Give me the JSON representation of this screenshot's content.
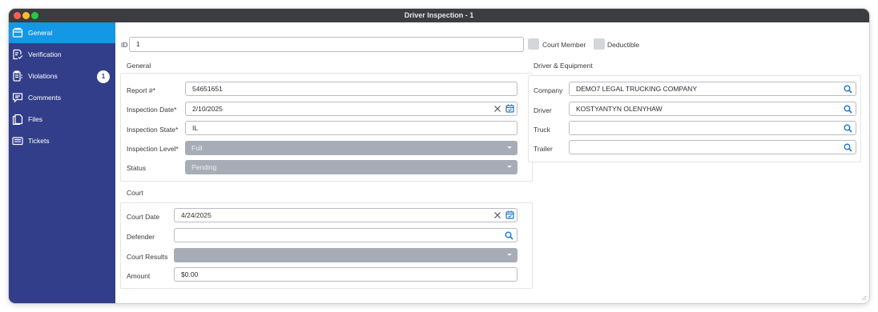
{
  "window": {
    "title": "Driver Inspection - 1"
  },
  "sidebar": {
    "items": [
      {
        "label": "General",
        "icon": "drawer-icon",
        "active": true
      },
      {
        "label": "Verification",
        "icon": "document-check-icon"
      },
      {
        "label": "Violations",
        "icon": "clipboard-list-icon",
        "badge": "1"
      },
      {
        "label": "Comments",
        "icon": "comment-icon"
      },
      {
        "label": "Files",
        "icon": "files-icon"
      },
      {
        "label": "Tickets",
        "icon": "ticket-icon"
      }
    ]
  },
  "top": {
    "id_label": "ID",
    "id_value": "1",
    "court_member_label": "Court Member",
    "deductible_label": "Deductible"
  },
  "general": {
    "title": "General",
    "report_label": "Report #*",
    "report_value": "54651651",
    "inspection_date_label": "Inspection Date*",
    "inspection_date_value": "2/10/2025",
    "inspection_state_label": "Inspection State*",
    "inspection_state_value": "IL",
    "inspection_level_label": "Inspection Level*",
    "inspection_level_value": "Full",
    "status_label": "Status",
    "status_value": "Pending"
  },
  "court": {
    "title": "Court",
    "court_date_label": "Court Date",
    "court_date_value": "4/24/2025",
    "defender_label": "Defender",
    "defender_value": "",
    "court_results_label": "Court Results",
    "court_results_value": "",
    "amount_label": "Amount",
    "amount_value": "$0.00"
  },
  "driver_equipment": {
    "title": "Driver & Equipment",
    "company_label": "Company",
    "company_value": "DEMO7 LEGAL TRUCKING COMPANY",
    "driver_label": "Driver",
    "driver_value": "KOSTYANTYN OLENYHAW",
    "truck_label": "Truck",
    "truck_value": "",
    "trailer_label": "Trailer",
    "trailer_value": ""
  },
  "colors": {
    "sidebar_bg": "#323e8a",
    "active_item": "#1497e4",
    "accent_icon": "#1976d2",
    "select_bg": "#a7adb7",
    "titlebar": "#3b3d41"
  }
}
